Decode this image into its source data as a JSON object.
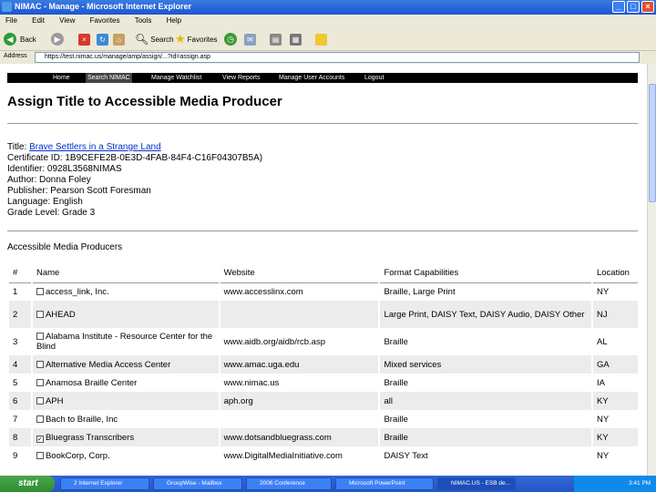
{
  "window": {
    "title": "NIMAC - Manage - Microsoft Internet Explorer"
  },
  "menu": [
    "File",
    "Edit",
    "View",
    "Favorites",
    "Tools",
    "Help"
  ],
  "toolbar": {
    "back": "Back",
    "search": "Search",
    "favorites": "Favorites"
  },
  "address": {
    "label": "Address",
    "url": "https://test.nimac.us/manage/amp/assign/...?id=assign.asp"
  },
  "nav": [
    "Home",
    "Search NIMAC",
    "Manage Watchlist",
    "View Reports",
    "Manage User Accounts",
    "Logout"
  ],
  "page": {
    "heading": "Assign Title to Accessible Media Producer",
    "title_label": "Title:",
    "title_value": "Brave Settlers in a Strange Land",
    "certificate": "Certificate ID: 1B9CEFE2B-0E3D-4FAB-84F4-C16F04307B5A)",
    "identifier": "Identifier: 0928L3568NIMAS",
    "author": "Author: Donna Foley",
    "publisher": "Publisher: Pearson Scott Foresman",
    "language": "Language: English",
    "grade": "Grade Level: Grade 3",
    "amp_heading": "Accessible Media Producers"
  },
  "table": {
    "headers": [
      "#",
      "Name",
      "Website",
      "Format Capabilities",
      "Location"
    ],
    "rows": [
      {
        "num": "1",
        "name": "access_link, Inc.",
        "website": "www.accesslinx.com",
        "formats": "Braille, Large Print",
        "location": "NY",
        "checked": false
      },
      {
        "num": "2",
        "name": "AHEAD",
        "website": "",
        "formats": "Large Print, DAISY Text, DAISY Audio, DAISY Other",
        "location": "NJ",
        "checked": false
      },
      {
        "num": "3",
        "name": "Alabama Institute - Resource Center for the Blind",
        "website": "www.aidb.org/aidb/rcb.asp",
        "formats": "Braille",
        "location": "AL",
        "checked": false
      },
      {
        "num": "4",
        "name": "Alternative Media Access Center",
        "website": "www.amac.uga.edu",
        "formats": "Mixed services",
        "location": "GA",
        "checked": false
      },
      {
        "num": "5",
        "name": "Anamosa Braille Center",
        "website": "www.nimac.us",
        "formats": "Braille",
        "location": "IA",
        "checked": false
      },
      {
        "num": "6",
        "name": "APH",
        "website": "aph.org",
        "formats": "all",
        "location": "KY",
        "checked": false
      },
      {
        "num": "7",
        "name": "Bach to Braille, Inc",
        "website": "",
        "formats": "Braille",
        "location": "NY",
        "checked": false
      },
      {
        "num": "8",
        "name": "Bluegrass Transcribers",
        "website": "www.dotsandbluegrass.com",
        "formats": "Braille",
        "location": "KY",
        "checked": true
      },
      {
        "num": "9",
        "name": "BookCorp, Corp.",
        "website": "www.DigitalMediaInitiative.com",
        "formats": "DAISY Text",
        "location": "NY",
        "checked": false
      }
    ]
  },
  "taskbar": {
    "start": "start",
    "tasks": [
      "2 Internet Explorer",
      "GroupWise - Mailbox",
      "2006 Conference",
      "Microsoft PowerPoint",
      "NIMAC.US - ESB de..."
    ],
    "time": "3:41 PM"
  }
}
